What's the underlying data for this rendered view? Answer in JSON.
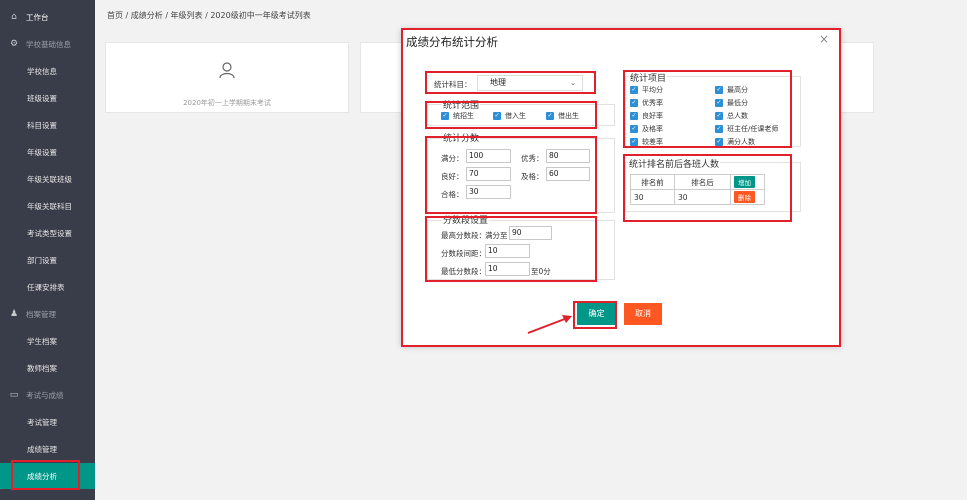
{
  "sidebar": {
    "workbench": "工作台",
    "school_info": "学校基础信息",
    "school_items": [
      "学校信息",
      "班级设置",
      "科目设置",
      "年级设置",
      "年级关联班级",
      "年级关联科目",
      "考试类型设置",
      "部门设置",
      "任课安排表"
    ],
    "archive": "档案管理",
    "archive_items": [
      "学生档案",
      "教师档案"
    ],
    "exam": "考试与成绩",
    "exam_items": [
      "考试管理",
      "成绩管理",
      "成绩分析"
    ]
  },
  "breadcrumb": "首页 / 成绩分析 / 年级列表 / 2020级初中一年级考试列表",
  "card": {
    "text": "2020年初一上学期期末考试"
  },
  "modal": {
    "title": "成绩分布统计分析",
    "close": "×",
    "subject_label": "统计科目：",
    "subject_value": "地理",
    "range": {
      "legend": "统计范围",
      "options": [
        "统招生",
        "借入生",
        "借出生"
      ]
    },
    "score": {
      "legend": "统计分数",
      "full_label": "满分：",
      "full_value": "100",
      "excellent_label": "优秀：",
      "excellent_value": "80",
      "good_label": "良好：",
      "good_value": "70",
      "pass_label": "及格：",
      "pass_value": "60",
      "qualified_label": "合格：",
      "qualified_value": "30"
    },
    "segment": {
      "legend": "分数段设置",
      "max_label": "最高分数段：",
      "max_prefix": "满分至",
      "max_value": "90",
      "interval_label": "分数段间距：",
      "interval_value": "10",
      "min_label": "最低分数段：",
      "min_value": "10",
      "min_suffix": "至0分"
    },
    "items": {
      "legend": "统计项目",
      "left": [
        "平均分",
        "优秀率",
        "良好率",
        "及格率",
        "较差率"
      ],
      "right": [
        "最高分",
        "最低分",
        "总人数",
        "班主任/任课老师",
        "满分人数"
      ]
    },
    "rank": {
      "legend": "统计排名前后各班人数",
      "col_front": "排名前",
      "col_back": "排名后",
      "add": "增加",
      "front_value": "30",
      "back_value": "30",
      "delete": "删除"
    },
    "confirm": "确定",
    "cancel": "取消"
  },
  "colors": {
    "sidebar": "#393d49",
    "accent": "#009688",
    "danger": "#ff5722",
    "highlight": "#e0202a"
  }
}
